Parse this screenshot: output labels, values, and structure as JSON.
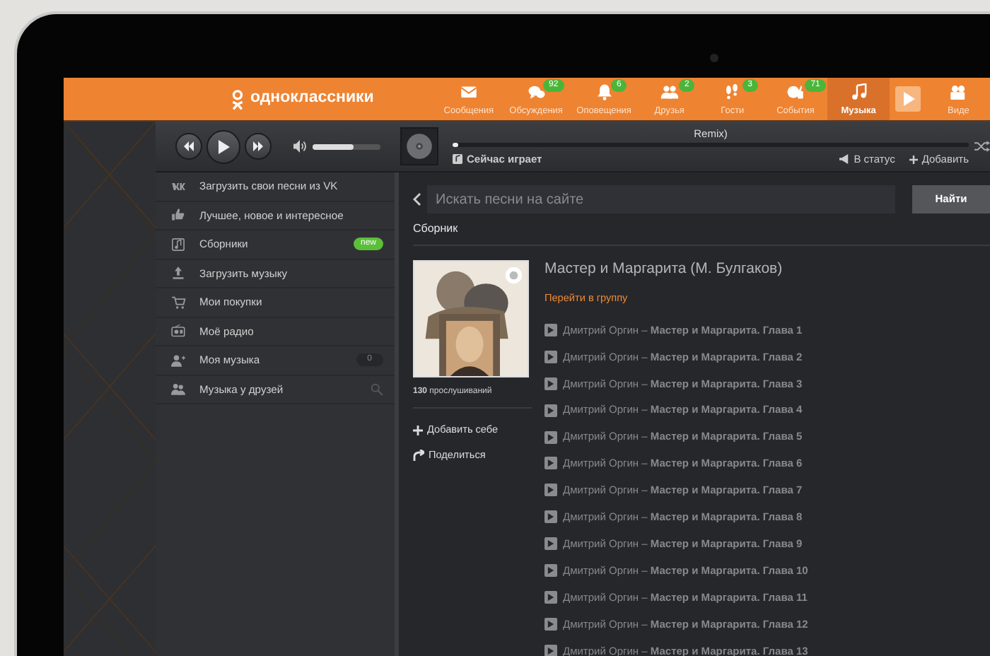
{
  "logo": {
    "text": "одноклассники"
  },
  "nav": [
    {
      "label": "Сообщения",
      "selected": false
    },
    {
      "label": "Обсуждения",
      "badge": "92",
      "selected": false
    },
    {
      "label": "Оповещения",
      "badge": "6",
      "selected": false
    },
    {
      "label": "Друзья",
      "badge": "2",
      "selected": false
    },
    {
      "label": "Гости",
      "badge": "3",
      "selected": false
    },
    {
      "label": "События",
      "badge": "71",
      "selected": false
    },
    {
      "label": "Музыка",
      "selected": true
    },
    {
      "label": "Виде",
      "selected": false
    }
  ],
  "player": {
    "track_title": "Remix)",
    "volume": {
      "level": 0.6
    },
    "progress": {
      "level": 0.01
    },
    "now_playing": "Сейчас играет",
    "actions": [
      "В статус",
      "Добавить"
    ]
  },
  "sidebar": {
    "items": [
      {
        "label": "Загрузить свои песни из VK",
        "kind": "link"
      },
      {
        "label": "Лучшее, новое и интересное",
        "kind": "link"
      },
      {
        "label": "Сборники",
        "kind": "new",
        "badge": "new"
      },
      {
        "label": "Загрузить музыку",
        "kind": "link"
      },
      {
        "label": "Мои покупки",
        "kind": "link"
      },
      {
        "label": "Моё радио",
        "kind": "link"
      },
      {
        "label": "Моя музыка",
        "kind": "count",
        "badge": "0"
      },
      {
        "label": "Музыка у друзей",
        "kind": "search"
      }
    ]
  },
  "search": {
    "placeholder": "Искать песни на сайте",
    "button": "Найти"
  },
  "section_title": "Сборник",
  "album": {
    "title": "Мастер и Маргарита (М. Булгаков)",
    "group_link": "Перейти в группу",
    "plays": "**130** прослушиваний",
    "actions": [
      "Добавить себе",
      "Поделиться"
    ],
    "tracks": [
      {
        "text": "Дмитрий Оргин – **Мастер и Маргарита. Глава 1**"
      },
      {
        "text": "Дмитрий Оргин – **Мастер и Маргарита. Глава 2**"
      },
      {
        "text": "Дмитрий Оргин – **Мастер и Маргарита. Глава 3**"
      },
      {
        "text": "Дмитрий Оргин – **Мастер и Маргарита. Глава 4**"
      },
      {
        "text": "Дмитрий Оргин – **Мастер и Маргарита. Глава 5**"
      },
      {
        "text": "Дмитрий Оргин – **Мастер и Маргарита. Глава 6**"
      },
      {
        "text": "Дмитрий Оргин – **Мастер и Маргарита. Глава 7**"
      },
      {
        "text": "Дмитрий Оргин – **Мастер и Маргарита. Глава 8**"
      },
      {
        "text": "Дмитрий Оргин – **Мастер и Маргарита. Глава 9**"
      },
      {
        "text": "Дмитрий Оргин – **Мастер и Маргарита. Глава 10**"
      },
      {
        "text": "Дмитрий Оргин – **Мастер и Маргарита. Глава 11**"
      },
      {
        "text": "Дмитрий Оргин – **Мастер и Маргарита. Глава 12**"
      },
      {
        "text": "Дмитрий Оргин – **Мастер и Маргарита. Глава 13**"
      }
    ]
  }
}
